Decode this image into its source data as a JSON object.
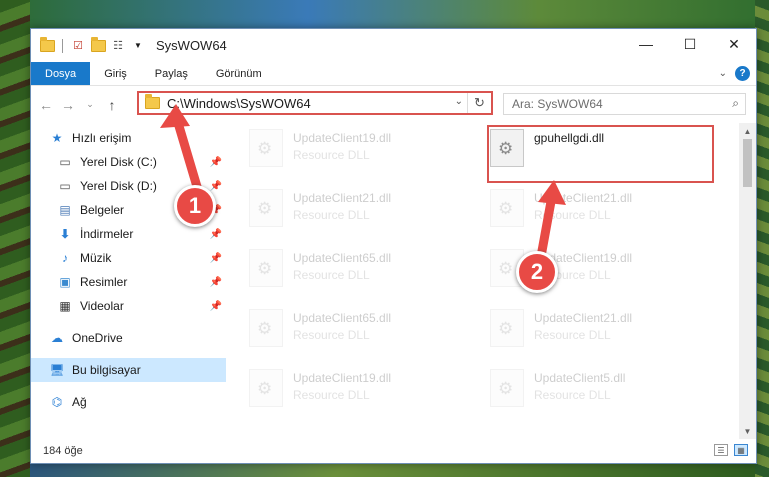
{
  "window": {
    "title": "SysWOW64"
  },
  "ribbon": {
    "tabs": [
      "Dosya",
      "Giriş",
      "Paylaş",
      "Görünüm"
    ]
  },
  "address": {
    "path": "C:\\Windows\\SysWOW64"
  },
  "search": {
    "placeholder": "Ara: SysWOW64"
  },
  "nav": {
    "quick_access": "Hızlı erişim",
    "items": [
      {
        "label": "Yerel Disk (C:)",
        "icon": "drive-icon"
      },
      {
        "label": "Yerel Disk (D:)",
        "icon": "drive-icon"
      },
      {
        "label": "Belgeler",
        "icon": "documents-icon"
      },
      {
        "label": "İndirmeler",
        "icon": "download-icon"
      },
      {
        "label": "Müzik",
        "icon": "music-icon"
      },
      {
        "label": "Resimler",
        "icon": "pictures-icon"
      },
      {
        "label": "Videolar",
        "icon": "videos-icon"
      }
    ],
    "onedrive": "OneDrive",
    "this_pc": "Bu bilgisayar",
    "network": "Ağ"
  },
  "files": {
    "col1": [
      {
        "name": "UpdateClient19.dll",
        "type": "Resource DLL"
      },
      {
        "name": "UpdateClient21.dll",
        "type": "Resource DLL"
      },
      {
        "name": "UpdateClient65.dll",
        "type": "Resource DLL"
      },
      {
        "name": "UpdateClient65.dll",
        "type": "Resource DLL"
      },
      {
        "name": "UpdateClient19.dll",
        "type": "Resource DLL"
      }
    ],
    "col2": [
      {
        "name": "gpuhellgdi.dll",
        "type": ""
      },
      {
        "name": "UpdateClient21.dll",
        "type": "Resource DLL"
      },
      {
        "name": "UpdateClient19.dll",
        "type": "Resource DLL"
      },
      {
        "name": "UpdateClient21.dll",
        "type": "Resource DLL"
      },
      {
        "name": "UpdateClient5.dll",
        "type": "Resource DLL"
      }
    ]
  },
  "status": {
    "count": "184 öğe"
  },
  "annotations": {
    "step1": "1",
    "step2": "2",
    "color": "#e84a45"
  }
}
